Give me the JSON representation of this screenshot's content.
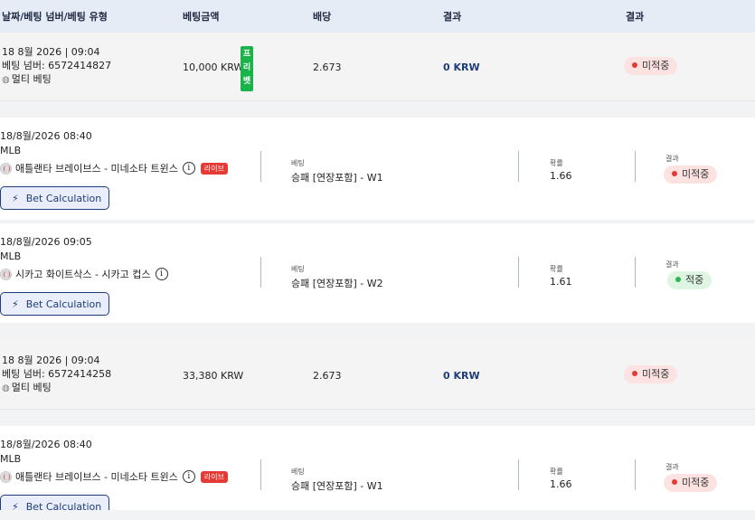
{
  "header": {
    "col1": "날짜/베팅 넘버/베팅 유형",
    "col2": "베팅금액",
    "col3": "배당",
    "col4": "결과",
    "col5": "결과"
  },
  "summaries": [
    {
      "date": "18 8월 2026 | 09:04",
      "bet_number": "베팅 넘버: 6572414827",
      "bet_type": "멀티 베팅",
      "amount": "10,000 KRW",
      "freebet": [
        "프",
        "리",
        "벳"
      ],
      "odds": "2.673",
      "result": "0 KRW",
      "status": "미적중"
    },
    {
      "date": "18 8월 2026 | 09:04",
      "bet_number": "베팅 넘버: 6572414258",
      "bet_type": "멀티 베팅",
      "amount": "33,380 KRW",
      "odds": "2.673",
      "result": "0 KRW",
      "status": "미적중"
    }
  ],
  "details": [
    {
      "datetime": "18/8월/2026 08:40",
      "league": "MLB",
      "match": "애틀랜타 브레이브스 - 미네소타 트윈스",
      "live_label": "라이브",
      "calc_label": "Bet Calculation",
      "bet_label": "베팅",
      "bet_value": "승패 [연장포함] - W1",
      "prob_label": "확률",
      "prob_value": "1.66",
      "result_label": "결과",
      "status": "미적중"
    },
    {
      "datetime": "18/8월/2026 09:05",
      "league": "MLB",
      "match": "시카고 화이트삭스 - 시카고 컵스",
      "calc_label": "Bet Calculation",
      "bet_label": "베팅",
      "bet_value": "승패 [연장포함] - W2",
      "prob_label": "확률",
      "prob_value": "1.61",
      "result_label": "결과",
      "status": "적중"
    },
    {
      "datetime": "18/8월/2026 08:40",
      "league": "MLB",
      "match": "애틀랜타 브레이브스 - 미네소타 트윈스",
      "live_label": "라이브",
      "calc_label": "Bet Calculation",
      "bet_label": "베팅",
      "bet_value": "승패 [연장포함] - W1",
      "prob_label": "확률",
      "prob_value": "1.66",
      "result_label": "결과",
      "status": "미적중"
    }
  ],
  "icons": {
    "info": "i",
    "bolt": "⚡",
    "multi": "◍"
  },
  "colors": {
    "header_bg": "#e6ecf5",
    "accent": "#1f3d7a",
    "lose": "#e53935",
    "win": "#2eb84f",
    "freebet": "#19b34a"
  }
}
